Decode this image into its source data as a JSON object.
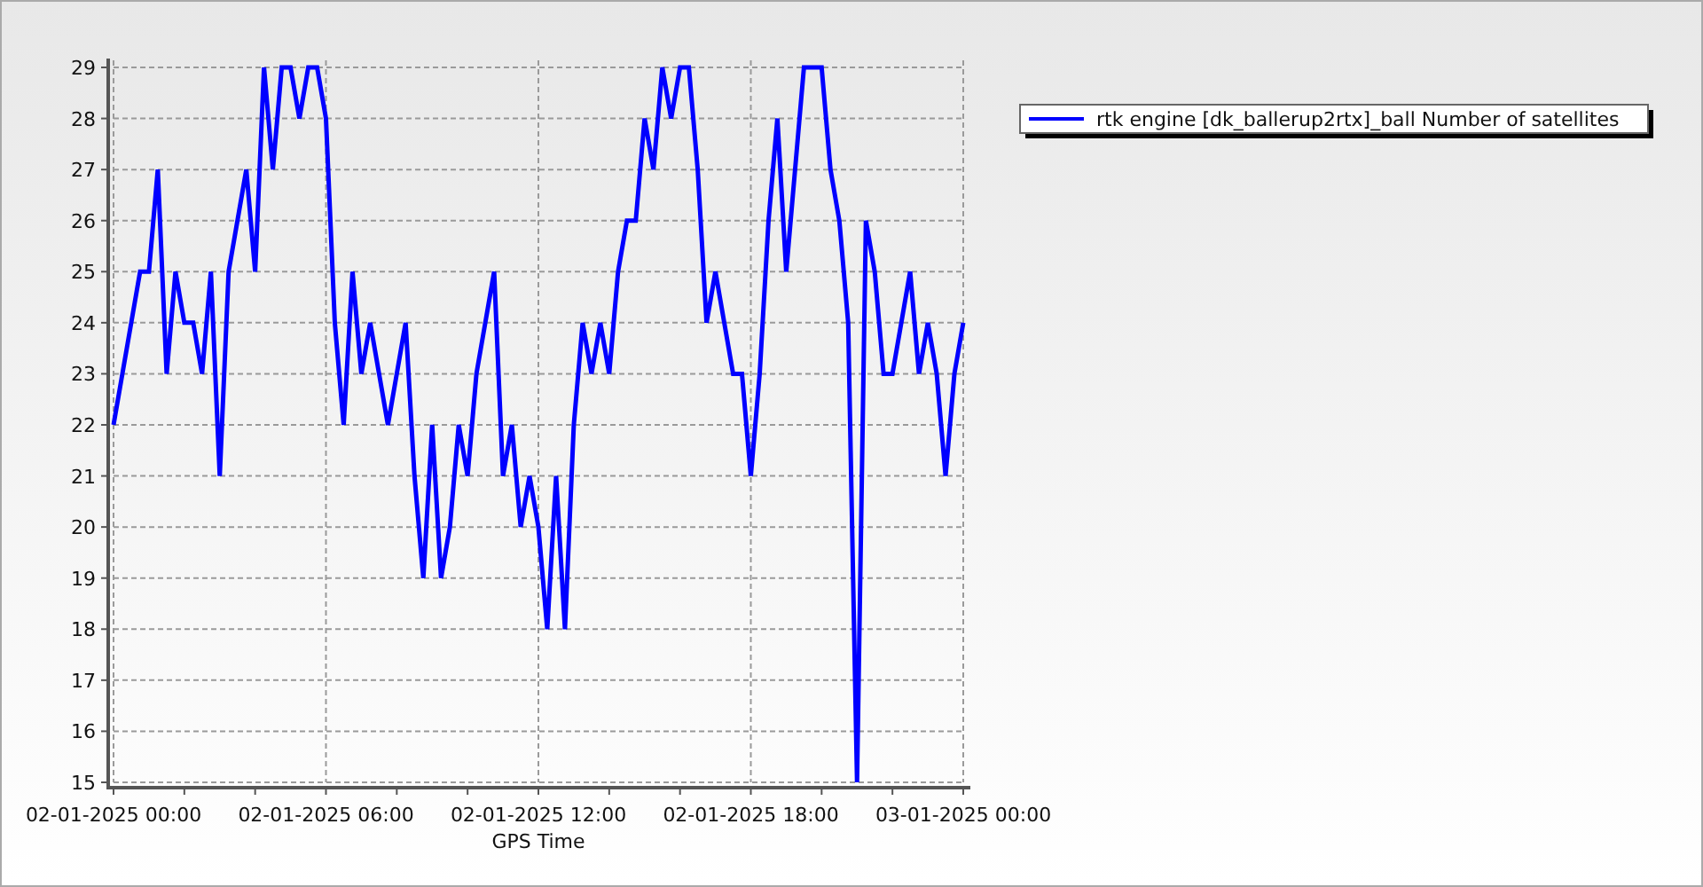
{
  "chart_data": {
    "type": "line",
    "grid": true,
    "xlabel": "GPS Time",
    "ylim": [
      15,
      29
    ],
    "yticks": [
      15,
      16,
      17,
      18,
      19,
      20,
      21,
      22,
      23,
      24,
      25,
      26,
      27,
      28,
      29
    ],
    "categories": [
      "02-01-2025 00:00",
      null,
      null,
      null,
      null,
      null,
      null,
      null,
      null,
      null,
      null,
      null,
      null,
      null,
      null,
      null,
      null,
      null,
      null,
      null,
      null,
      null,
      null,
      null,
      "02-01-2025 06:00",
      null,
      null,
      null,
      null,
      null,
      null,
      null,
      null,
      null,
      null,
      null,
      null,
      null,
      null,
      null,
      null,
      null,
      null,
      null,
      null,
      null,
      null,
      null,
      "02-01-2025 12:00",
      null,
      null,
      null,
      null,
      null,
      null,
      null,
      null,
      null,
      null,
      null,
      null,
      null,
      null,
      null,
      null,
      null,
      null,
      null,
      null,
      null,
      null,
      null,
      "02-01-2025 18:00",
      null,
      null,
      null,
      null,
      null,
      null,
      null,
      null,
      null,
      null,
      null,
      null,
      null,
      null,
      null,
      null,
      null,
      null,
      null,
      null,
      null,
      null,
      null,
      "03-01-2025 00:00"
    ],
    "series": [
      {
        "name": "rtk engine [dk_ballerup2rtx]_ball Number of satellites",
        "color": "#0000ff",
        "values": [
          22,
          23,
          24,
          25,
          25,
          27,
          23,
          25,
          24,
          24,
          23,
          25,
          21,
          25,
          26,
          27,
          25,
          29,
          27,
          29,
          29,
          28,
          29,
          29,
          28,
          24,
          22,
          25,
          23,
          24,
          23,
          22,
          23,
          24,
          21,
          19,
          22,
          19,
          20,
          22,
          21,
          23,
          24,
          25,
          21,
          22,
          20,
          21,
          20,
          18,
          21,
          18,
          22,
          24,
          23,
          24,
          23,
          25,
          26,
          26,
          28,
          27,
          29,
          28,
          29,
          29,
          27,
          24,
          25,
          24,
          23,
          23,
          21,
          23,
          26,
          28,
          25,
          27,
          29,
          29,
          29,
          27,
          26,
          24,
          15,
          26,
          25,
          23,
          23,
          24,
          25,
          23,
          24,
          23,
          21,
          23,
          24
        ]
      }
    ]
  }
}
